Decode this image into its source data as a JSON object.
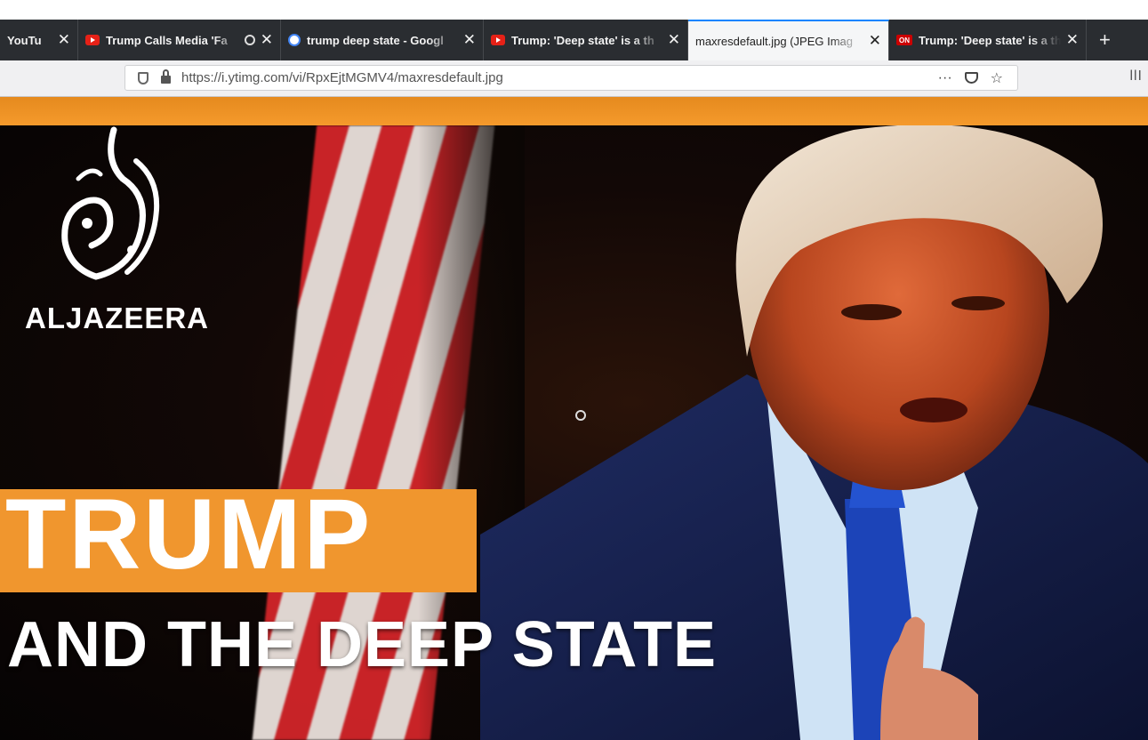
{
  "browser": {
    "tabs": [
      {
        "title": "YouTu",
        "favicon": "youtube-icon",
        "active": false
      },
      {
        "title": "Trump Calls Media 'Fa",
        "favicon": "youtube-icon",
        "active": false,
        "audio": true
      },
      {
        "title": "trump deep state - Googl",
        "favicon": "google-icon",
        "active": false
      },
      {
        "title": "Trump: 'Deep state' is a th",
        "favicon": "youtube-icon",
        "active": false
      },
      {
        "title": "maxresdefault.jpg (JPEG Imag",
        "favicon": "",
        "active": true
      },
      {
        "title": "Trump: 'Deep state' is a th",
        "favicon": "cnn-icon",
        "favicon_text": "ON",
        "active": false
      }
    ],
    "close_glyph": "✕",
    "new_tab_glyph": "+",
    "url": "https://i.ytimg.com/vi/RpxEjtMGMV4/maxresdefault.jpg",
    "page_actions_glyph": "···",
    "star_glyph": "☆",
    "sidebar_glyph": "llI"
  },
  "image": {
    "brand_name": "ALJAZEERA",
    "headline": "TRUMP",
    "subheadline": "AND THE DEEP STATE",
    "colors": {
      "accent_orange": "#f0962e",
      "flag_red": "#d8262a",
      "suit_blue": "#17204a",
      "tie_blue": "#1c44b8"
    }
  }
}
